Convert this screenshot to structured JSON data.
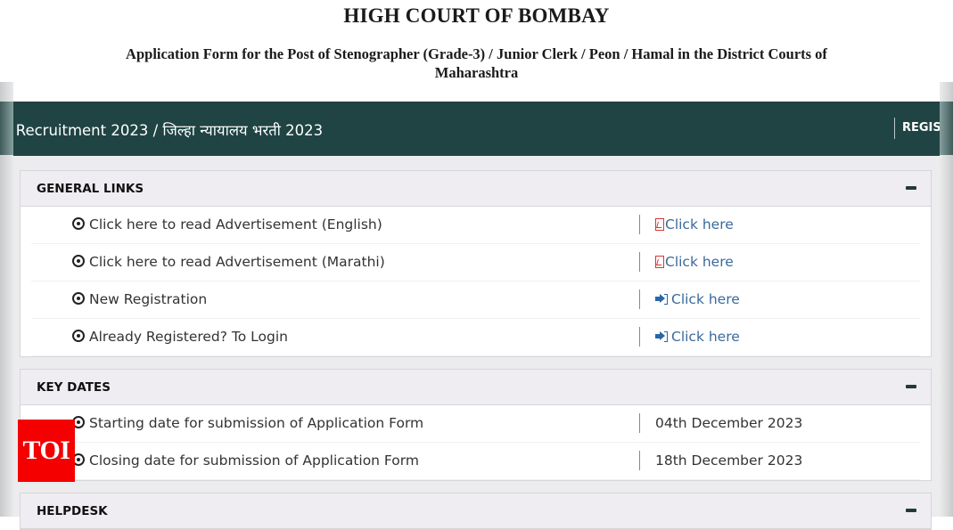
{
  "header": {
    "title": "HIGH COURT OF BOMBAY",
    "subtitle": "Application Form for the Post of Stenographer (Grade-3) / Junior Clerk / Peon / Hamal in the District Courts of Maharashtra"
  },
  "navbar": {
    "title": "t Recruitment 2023 / जिल्हा न्यायालय भरती 2023",
    "register_label": "REGIST"
  },
  "panels": [
    {
      "title": "GENERAL LINKS",
      "collapse_icon": "minus-icon",
      "rows": [
        {
          "label": "Click here to read Advertisement (English)",
          "action": "Click here",
          "icon": "file-pdf-icon"
        },
        {
          "label": "Click here to read Advertisement (Marathi)",
          "action": "Click here",
          "icon": "file-pdf-icon"
        },
        {
          "label": "New Registration",
          "action": "Click here",
          "icon": "sign-in-icon"
        },
        {
          "label": "Already Registered? To Login",
          "action": "Click here",
          "icon": "sign-in-icon"
        }
      ]
    },
    {
      "title": "KEY DATES",
      "collapse_icon": "minus-icon",
      "rows": [
        {
          "label": "Starting date for submission of Application Form",
          "value": "04th December 2023"
        },
        {
          "label": "Closing date for submission of Application Form",
          "value": "18th December 2023"
        }
      ]
    },
    {
      "title": "HELPDESK",
      "collapse_icon": "minus-icon"
    }
  ],
  "watermark": {
    "text": "TOI",
    "color": "#f40000"
  },
  "colors": {
    "navbar_bg": "#1f4443",
    "link": "#3a6a9c",
    "pdf_icon": "#dd3333",
    "signin_icon": "#2a66a8"
  }
}
